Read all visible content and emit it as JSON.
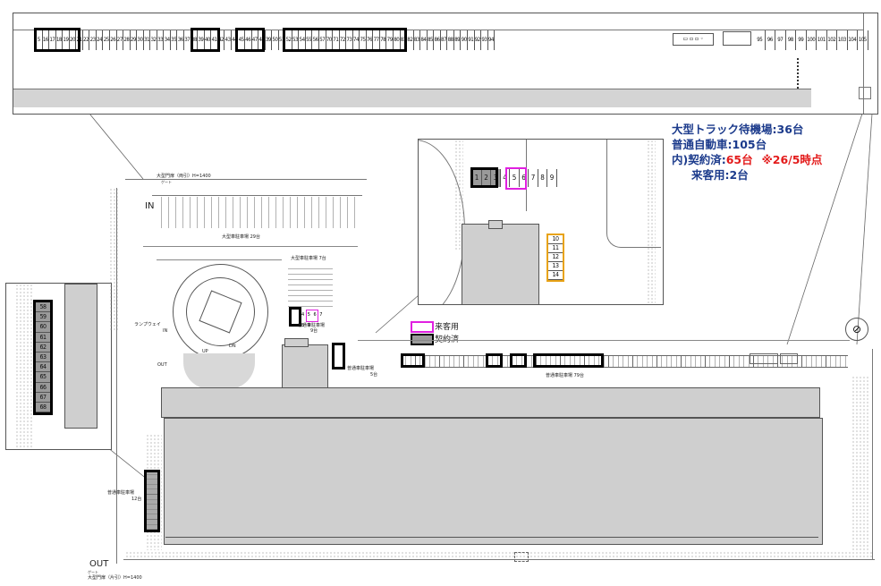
{
  "summary": {
    "truck_waiting": "大型トラック待機場:36台",
    "cars_total": "普通自動車:105台",
    "contracted_prefix": "内)契約済:",
    "contracted_count": "65台",
    "contracted_note": "※26/5時点",
    "visitor": "来客用:2台"
  },
  "legend": {
    "visitor_label": "来客用",
    "contracted_label": "契約済",
    "visitor_color": "#e020e0",
    "contracted_color": "#555555"
  },
  "top_strip": {
    "stall_numbers_a": [
      "5",
      "16",
      "17",
      "18",
      "19",
      "20",
      "21",
      "22",
      "23",
      "24",
      "25",
      "26",
      "27",
      "28",
      "29",
      "30",
      "31",
      "32",
      "33",
      "34",
      "35",
      "36",
      "37",
      "38",
      "39",
      "40",
      "41",
      "42",
      "43",
      "44",
      "45",
      "46",
      "47",
      "48",
      "39",
      "50",
      "51",
      "52",
      "53",
      "54",
      "55",
      "56",
      "57",
      "70",
      "71",
      "72",
      "73",
      "74",
      "75",
      "76",
      "77",
      "78",
      "79",
      "80",
      "81",
      "82",
      "83",
      "84",
      "85",
      "86",
      "87",
      "88",
      "89",
      "90",
      "91",
      "92",
      "93",
      "94"
    ],
    "stall_numbers_b": [
      "95",
      "96",
      "97",
      "98",
      "99",
      "100",
      "101",
      "102",
      "103",
      "104",
      "105"
    ]
  },
  "inset_right": {
    "stalls_top": [
      "1",
      "2",
      "3",
      "4",
      "5",
      "6",
      "7",
      "8",
      "9"
    ],
    "stalls_side": [
      "10",
      "11",
      "12",
      "13",
      "14"
    ]
  },
  "inset_left": {
    "stalls": [
      "58",
      "59",
      "60",
      "61",
      "62",
      "63",
      "64",
      "65",
      "66",
      "67",
      "68"
    ]
  },
  "map_labels": {
    "gate_top": "大型門扉（両引）H=1400",
    "gate_top_sub": "ゲート",
    "in_label": "IN",
    "truck_area": "大型車駐車場 29台",
    "truck_area_small": "大型車駐車場 7台",
    "ramp": "ランプウェイ",
    "ramp_in": "IN",
    "ramp_out": "OUT",
    "up": "UP",
    "dn": "DN",
    "car_area_center": "普通車駐車場",
    "car_area_center_count": "9台",
    "car_area_side": "普通車駐車場",
    "car_area_side_count": "5台",
    "car_area_long": "普通車駐車場 79台",
    "car_area_left": "普通車駐車場",
    "car_area_left_count": "12台",
    "out_label": "OUT",
    "gate_bottom_sub": "ゲート",
    "gate_bottom": "大型門扉（片引）H=1400",
    "row_numbers_bottom": "50|51|52|53|54|55|56|57|58|59|60|61|62|63|64|65|66|67|68|69|70|71|72|73|74|75|76|77|78|79|80|81|82|83|84|85|86|87|88|89|90|91|92|93|94"
  }
}
